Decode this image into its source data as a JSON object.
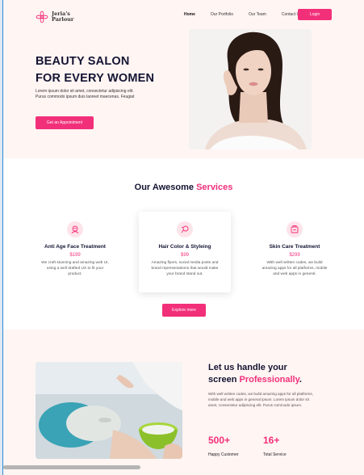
{
  "brand": {
    "name_line1": "Jeria's",
    "name_line2": "Parlour"
  },
  "nav": {
    "items": [
      "Home",
      "Our Portfolio",
      "Our Team",
      "Contact Us"
    ],
    "login": "Login"
  },
  "hero": {
    "title_line1": "BEAUTY SALON",
    "title_line2": "FOR EVERY WOMEN",
    "description": "Lorem ipsum dolor sit amet, consectetur adipiscing elit. Purus commodo ipsum duis laoreet maecenas. Feugiat",
    "cta": "Get an Appointment"
  },
  "services": {
    "title_plain": "Our Awesome ",
    "title_accent": "Services",
    "items": [
      {
        "title": "Anti Age Face Treatment",
        "price": "$199",
        "desc": "We craft stunning and amazing web UI, using a well drafted UX to fit your product."
      },
      {
        "title": "Hair Color & Styleing",
        "price": "$99",
        "desc": "Amazing flyers, social media posts and brand representations that would make your brand stand out."
      },
      {
        "title": "Skin Care Treatment",
        "price": "$299",
        "desc": "With well written codes, we build amazing apps for all platforms, mobile and web apps in general."
      }
    ],
    "explore": "Explore more"
  },
  "about": {
    "title_line1": "Let us handle your",
    "title_line2_plain": "screen ",
    "title_line2_accent": "Professionally",
    "title_line2_end": ".",
    "description": "With well written codes, we build amazing apps for all platforms, mobile and web apps in general ipsum. Lorem ipsum dolor sit amet, consectetur adipiscing elit. Purus commodo ipsum.",
    "stats": [
      {
        "value": "500+",
        "label": "Happy Customer"
      },
      {
        "value": "16+",
        "label": "Total Service"
      }
    ]
  },
  "colors": {
    "accent": "#f2307a",
    "hero_bg": "#fff5f3",
    "heading": "#141433"
  }
}
